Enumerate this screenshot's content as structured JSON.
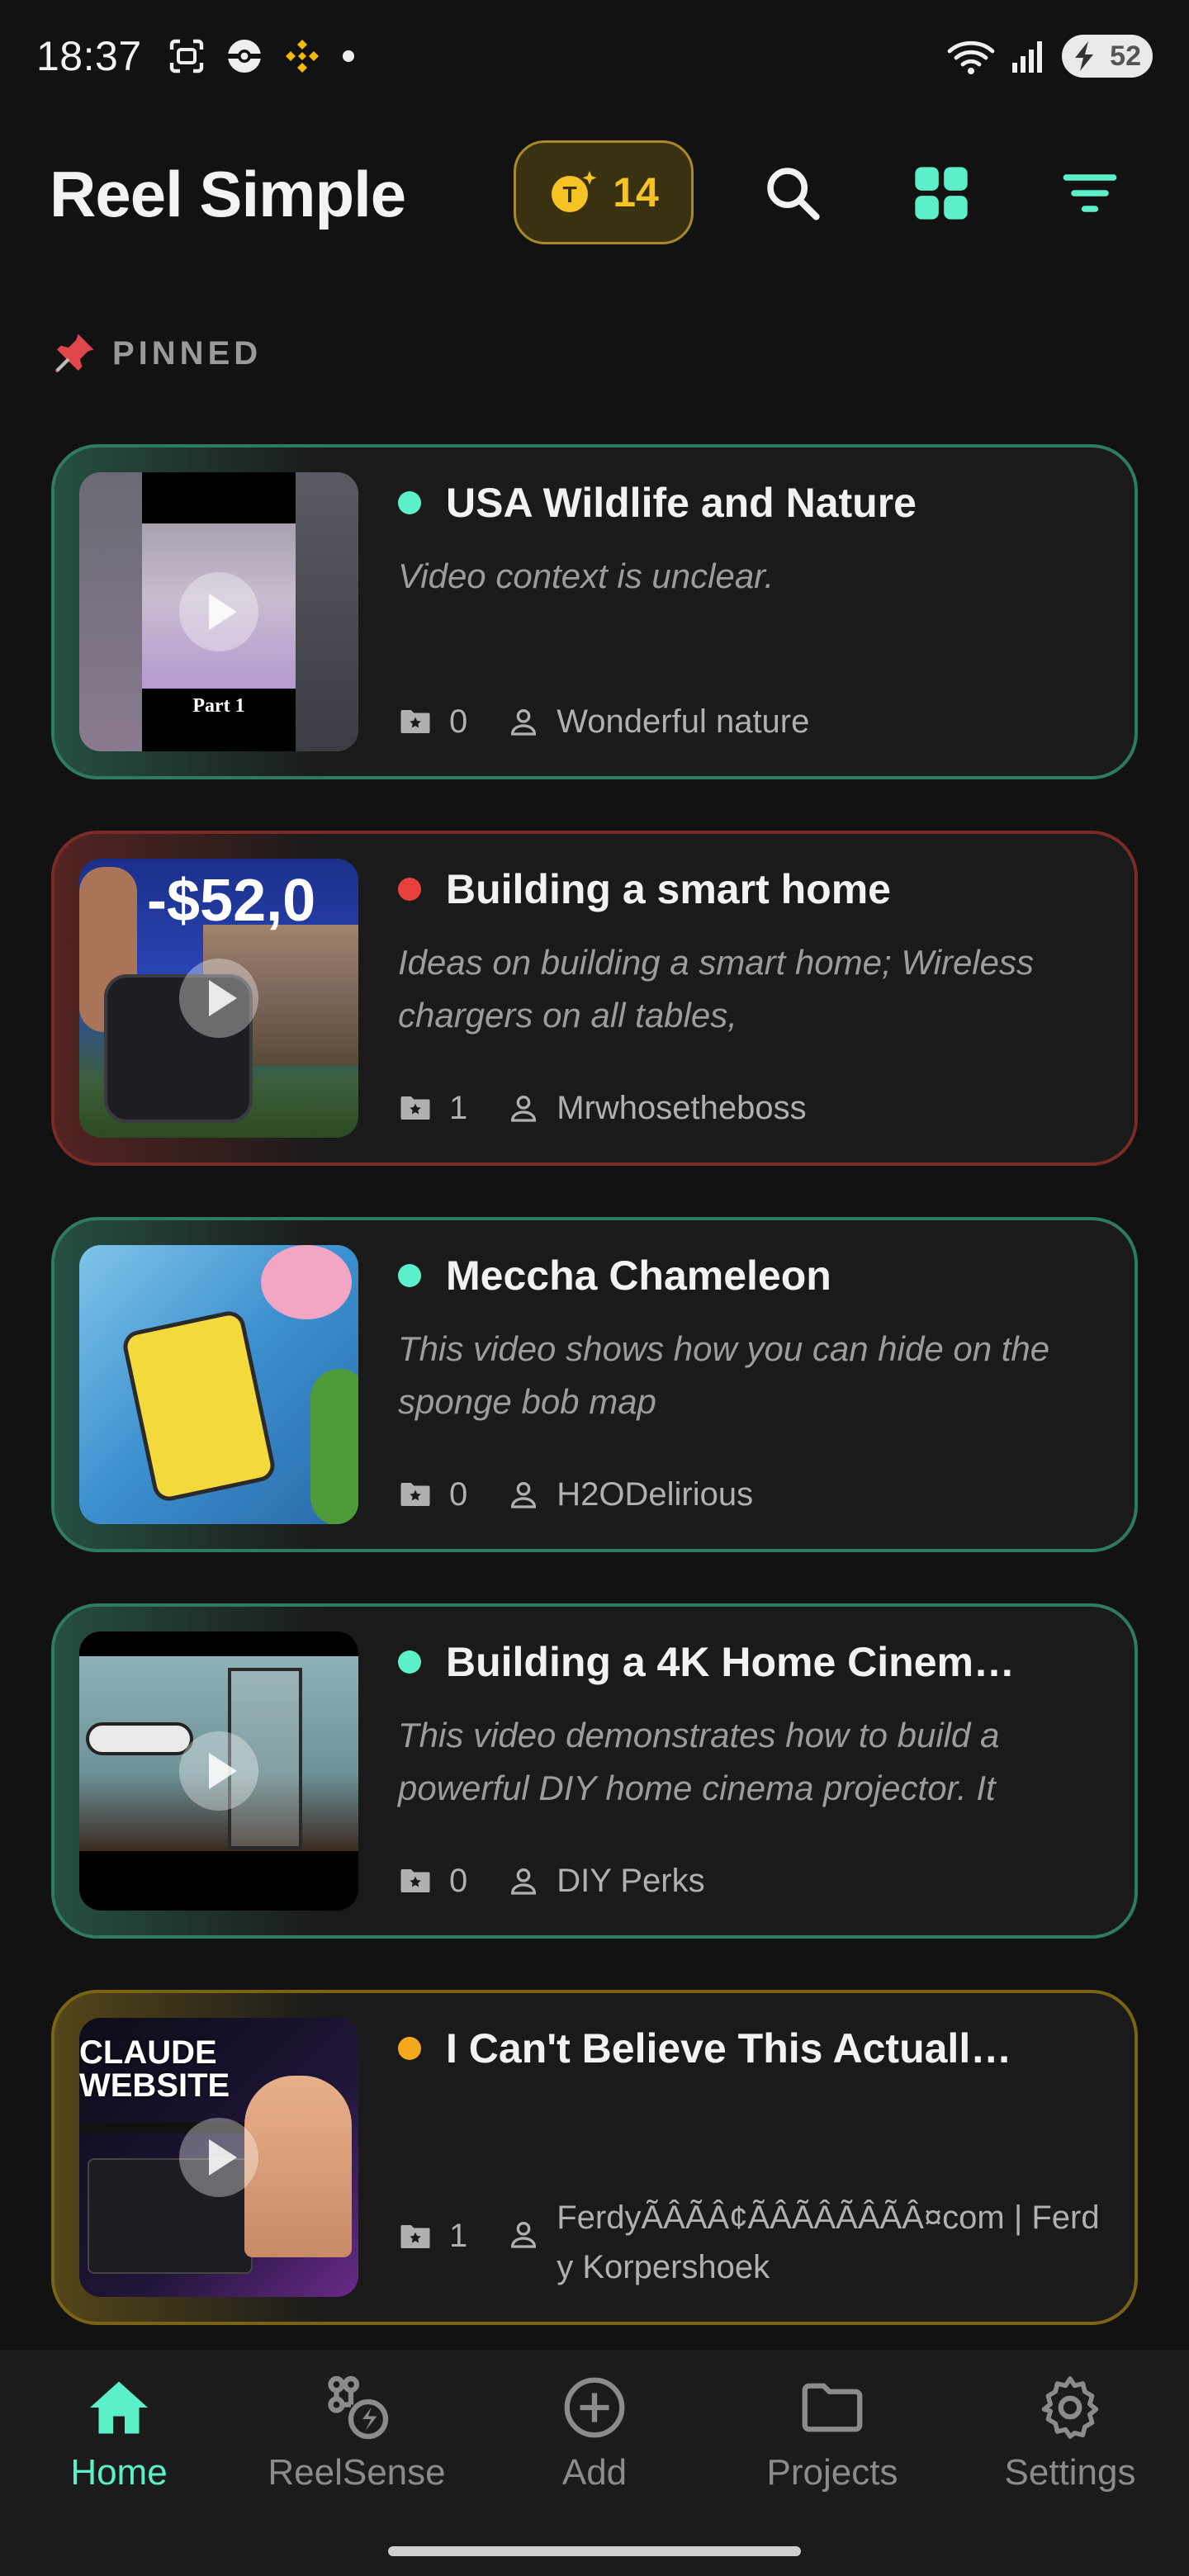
{
  "status_bar": {
    "time": "18:37",
    "battery": "52",
    "icons": [
      "screenshot-icon",
      "pokeball-icon",
      "binance-icon",
      "notification-dot-icon",
      "wifi-icon",
      "signal-icon",
      "battery-icon"
    ]
  },
  "header": {
    "title": "Reel Simple",
    "credits": "14",
    "icons": [
      "search-icon",
      "grid-view-icon",
      "filter-icon"
    ]
  },
  "pinned_label": "PINNED",
  "cards": [
    {
      "title": "USA Wildlife and Nature",
      "description": "Video context is unclear.",
      "count": "0",
      "author": "Wonderful nature",
      "dot_color": "#5cf0c9",
      "border_color": "#2f7a63",
      "thumb_caption": "Part 1"
    },
    {
      "title": "Building a smart home",
      "description": "Ideas on building a smart home; Wireless chargers on all tables,",
      "count": "1",
      "author": "Mrwhosetheboss",
      "dot_color": "#e8413b",
      "border_color": "#7a2a27",
      "thumb_caption": "-$52,0"
    },
    {
      "title": "Meccha Chameleon",
      "description": "This video shows how you can hide on the sponge bob map",
      "count": "0",
      "author": "H2ODelirious",
      "dot_color": "#5cf0c9",
      "border_color": "#2f7a63",
      "thumb_caption": ""
    },
    {
      "title": "Building a 4K Home Cinem…",
      "description": "This video demonstrates how to build a powerful DIY home cinema projector. It",
      "count": "0",
      "author": "DIY Perks",
      "dot_color": "#5cf0c9",
      "border_color": "#2f7a63",
      "thumb_caption": ""
    },
    {
      "title": "I Can't Believe This Actuall…",
      "description": "",
      "count": "1",
      "author": "FerdyÃÂÃÂ¢ÃÂÃÂÃÂÃÂ¤com | Ferdy Korpershoek",
      "dot_color": "#f4a81d",
      "border_color": "#7a6317",
      "thumb_caption": "CLAUDE WEBSITE"
    }
  ],
  "bottom_nav": [
    {
      "label": "Home",
      "icon": "home-icon",
      "active": true
    },
    {
      "label": "ReelSense",
      "icon": "reelsense-icon",
      "active": false
    },
    {
      "label": "Add",
      "icon": "add-circle-icon",
      "active": false
    },
    {
      "label": "Projects",
      "icon": "folder-icon",
      "active": false
    },
    {
      "label": "Settings",
      "icon": "gear-icon",
      "active": false
    }
  ],
  "colors": {
    "accent": "#5cf0c9",
    "credits": "#f5c324",
    "background": "#121212"
  }
}
